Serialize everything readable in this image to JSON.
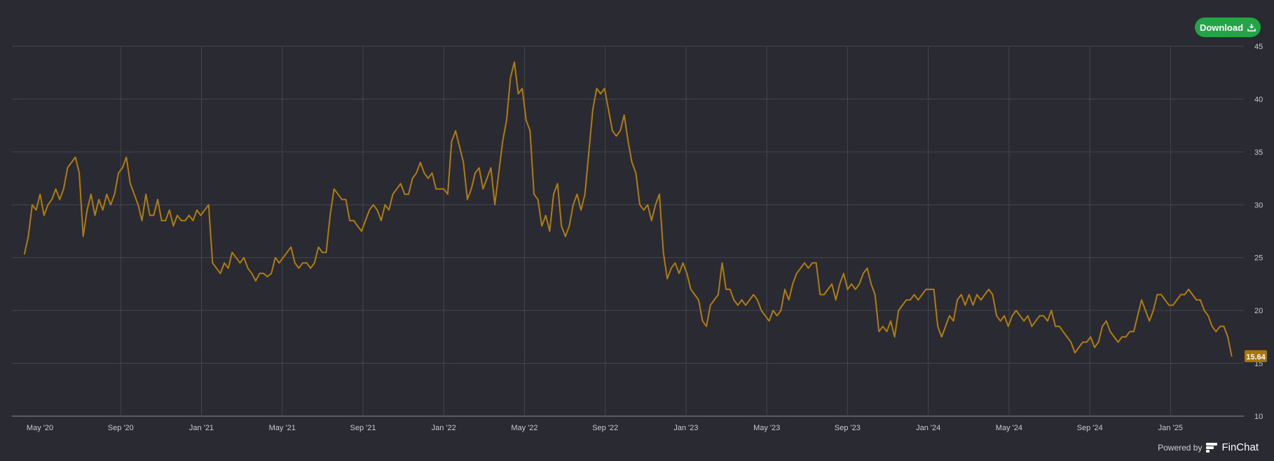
{
  "toolbar": {
    "download_label": "Download",
    "download_icon": "download-icon"
  },
  "footer": {
    "powered_by": "Powered by",
    "brand": "FinChat"
  },
  "colors": {
    "line": "#b07d0c",
    "badge": "#a8770b",
    "button": "#22a447",
    "background": "#2a2a32"
  },
  "chart_data": {
    "type": "line",
    "title": "",
    "xlabel": "",
    "ylabel": "",
    "ylim": [
      10,
      45
    ],
    "yticks": [
      "10",
      "15",
      "20",
      "25",
      "30",
      "35",
      "40",
      "45"
    ],
    "xticks": [
      {
        "month": 4,
        "label": "May '20"
      },
      {
        "month": 8,
        "label": "Sep '20"
      },
      {
        "month": 12,
        "label": "Jan '21"
      },
      {
        "month": 16,
        "label": "May '21"
      },
      {
        "month": 20,
        "label": "Sep '21"
      },
      {
        "month": 24,
        "label": "Jan '22"
      },
      {
        "month": 28,
        "label": "May '22"
      },
      {
        "month": 32,
        "label": "Sep '22"
      },
      {
        "month": 36,
        "label": "Jan '23"
      },
      {
        "month": 40,
        "label": "May '23"
      },
      {
        "month": 44,
        "label": "Sep '23"
      },
      {
        "month": 48,
        "label": "Jan '24"
      },
      {
        "month": 52,
        "label": "May '24"
      },
      {
        "month": 56,
        "label": "Sep '24"
      },
      {
        "month": 60,
        "label": "Jan '25"
      }
    ],
    "x_unit": "months since Jan 2020",
    "x_start": 3.23,
    "x_end": 63.03,
    "last_value_label": "15.64",
    "grid": true,
    "series": [
      {
        "name": "value",
        "values": [
          25.3,
          27,
          30,
          29.5,
          31,
          29,
          30,
          30.5,
          31.5,
          30.5,
          31.5,
          33.5,
          34,
          34.5,
          33,
          27,
          29.5,
          31,
          29,
          30.5,
          29.5,
          31,
          30,
          31,
          33,
          33.5,
          34.5,
          32,
          31,
          30,
          28.5,
          31,
          29,
          29,
          30.5,
          28.5,
          28.5,
          29.5,
          28,
          29,
          28.5,
          28.5,
          29,
          28.5,
          29.5,
          29,
          29.5,
          30,
          24.5,
          24,
          23.5,
          24.5,
          24,
          25.5,
          25,
          24.5,
          25,
          24,
          23.5,
          22.8,
          23.5,
          23.5,
          23.2,
          23.5,
          25,
          24.5,
          25,
          25.5,
          26,
          24.5,
          24,
          24.5,
          24.5,
          24,
          24.5,
          26,
          25.5,
          25.5,
          29,
          31.5,
          31,
          30.5,
          30.5,
          28.5,
          28.5,
          28,
          27.5,
          28.5,
          29.5,
          30,
          29.5,
          28.5,
          30,
          29.5,
          31,
          31.5,
          32,
          31,
          31,
          32.5,
          33,
          34,
          33,
          32.5,
          33,
          31.5,
          31.5,
          31.5,
          31,
          36,
          37,
          35.5,
          34,
          30.5,
          31.5,
          33,
          33.5,
          31.5,
          32.5,
          33.5,
          30,
          33,
          36,
          38,
          42,
          43.5,
          40.5,
          41,
          38,
          37,
          31,
          30.5,
          28,
          29,
          27.5,
          31,
          32,
          28,
          27,
          28,
          30,
          31,
          29.5,
          31,
          35,
          39,
          41,
          40.5,
          41,
          39,
          37,
          36.5,
          37,
          38.5,
          36,
          34,
          33,
          30,
          29.5,
          30,
          28.5,
          30,
          31,
          25.5,
          23,
          24,
          24.5,
          23.5,
          24.5,
          23.5,
          22,
          21.5,
          21,
          19,
          18.5,
          20.5,
          21,
          21.5,
          24.5,
          22,
          22,
          21,
          20.5,
          21,
          20.5,
          21,
          21.5,
          21,
          20,
          19.5,
          19,
          20,
          19.5,
          20,
          22,
          21,
          22.5,
          23.5,
          24,
          24.5,
          24,
          24.5,
          24.5,
          21.5,
          21.5,
          22,
          22.5,
          21,
          22.5,
          23.5,
          22,
          22.5,
          22,
          22.5,
          23.5,
          24,
          22.5,
          21.5,
          18,
          18.5,
          18,
          19,
          17.5,
          20,
          20.5,
          21,
          21,
          21.5,
          21,
          21.5,
          22,
          22,
          22,
          18.5,
          17.5,
          18.5,
          19.5,
          19,
          21,
          21.5,
          20.5,
          21.5,
          20.5,
          21.5,
          21,
          21.5,
          22,
          21.5,
          19.5,
          19,
          19.5,
          18.5,
          19.5,
          20,
          19.5,
          19,
          19.5,
          18.5,
          19,
          19.5,
          19.5,
          19,
          20,
          18.5,
          18.5,
          18,
          17.5,
          17,
          16,
          16.5,
          17,
          17,
          17.5,
          16.5,
          17,
          18.5,
          19,
          18,
          17.5,
          17,
          17.5,
          17.5,
          18,
          18,
          19.5,
          21,
          20,
          19,
          20,
          21.5,
          21.5,
          21,
          20.5,
          20.5,
          21,
          21.5,
          21.5,
          22,
          21.5,
          21,
          21,
          20,
          19.5,
          18.5,
          18,
          18.5,
          18.5,
          17.5,
          15.64
        ]
      }
    ]
  }
}
